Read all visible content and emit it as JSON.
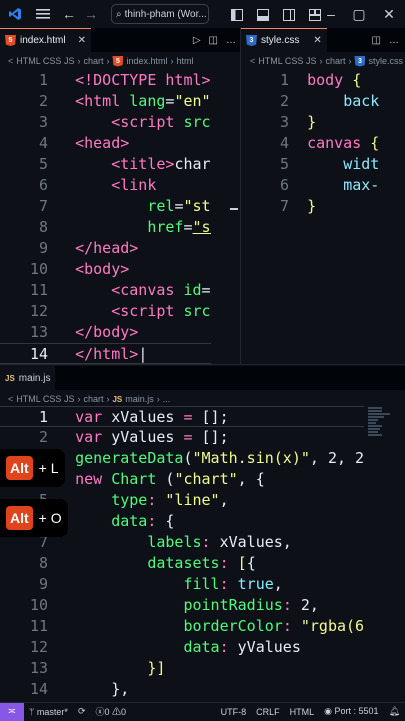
{
  "titlebar": {
    "search_text": "thinh-pham (Wor..."
  },
  "panes": {
    "html": {
      "tab_label": "index.html",
      "breadcrumb": [
        "HTML CSS JS",
        "chart",
        "index.html",
        "html"
      ],
      "active_line": 14
    },
    "css": {
      "tab_label": "style.css",
      "breadcrumb": [
        "HTML CSS JS",
        "chart",
        "style.css"
      ]
    },
    "js": {
      "tab_label": "main.js",
      "breadcrumb": [
        "HTML CSS JS",
        "chart",
        "main.js",
        "..."
      ]
    }
  },
  "shortcuts": [
    {
      "key": "Alt",
      "combo": "+ L"
    },
    {
      "key": "Alt",
      "combo": "+ O"
    }
  ],
  "statusbar": {
    "branch": "master*",
    "errors": "0",
    "warnings": "0",
    "encoding": "UTF-8",
    "eol": "CRLF",
    "language": "HTML",
    "port": "Port : 5501"
  },
  "colors": {
    "tag": "#ff79c6",
    "attr": "#50fa7b",
    "string": "#f1fa8c",
    "accent": "#8957e5"
  }
}
